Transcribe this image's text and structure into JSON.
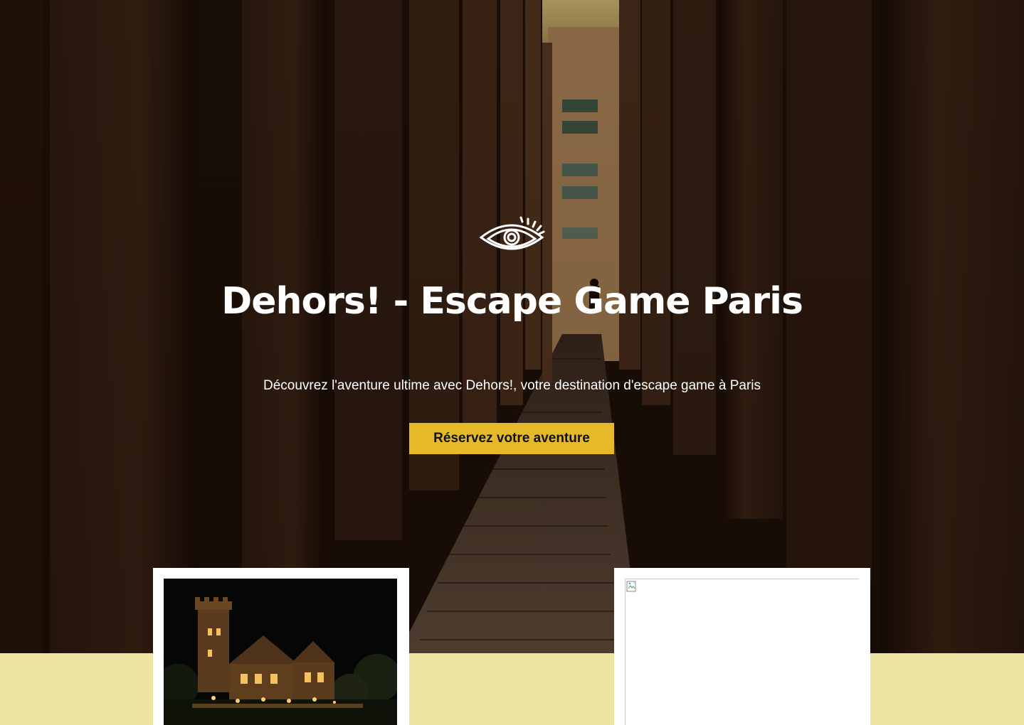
{
  "hero": {
    "title": "Dehors! - Escape Game Paris",
    "subtitle": "Découvrez l'aventure ultime avec Dehors!, votre destination d'escape game à Paris",
    "cta_label": "Réservez votre aventure",
    "logo_icon": "eye-icon"
  },
  "cards": [
    {
      "image": "castle-night-photo"
    },
    {
      "image": "broken-image-icon"
    }
  ],
  "colors": {
    "accent": "#e6b92b",
    "band": "#efe3a3",
    "hero_text": "#ffffff"
  }
}
